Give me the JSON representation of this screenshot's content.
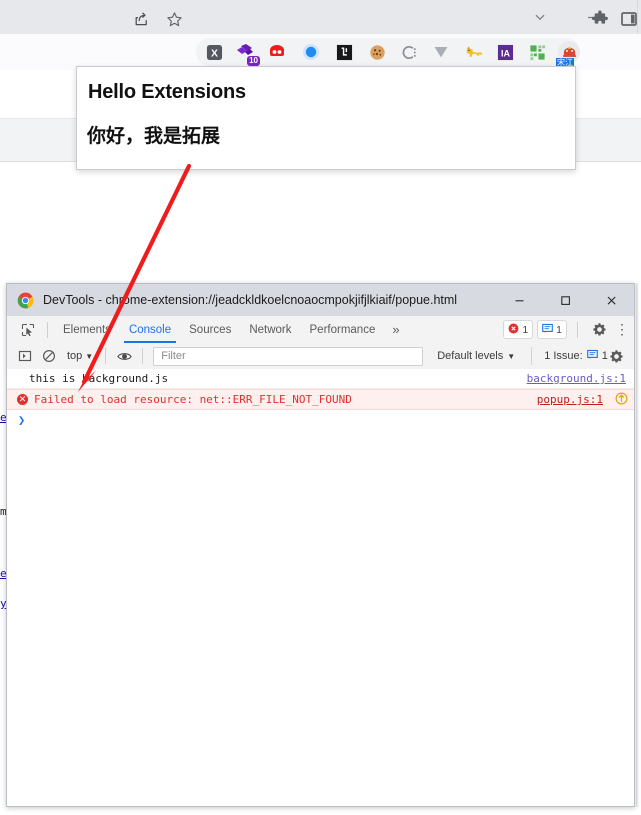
{
  "browser": {
    "titlebar": {
      "chevron_icon": "chevron-down-icon",
      "minimize_icon": "minimize-icon"
    },
    "toolbar": {
      "share_icon": "share-icon",
      "bookmark_star_icon": "star-icon",
      "puzzle_icon": "extensions-puzzle-icon",
      "sidepanel_icon": "side-panel-icon",
      "extensions": [
        {
          "name": "x-extension-icon",
          "glyph": "X",
          "badge": ""
        },
        {
          "name": "purple-diamond-extension-icon",
          "glyph": "",
          "badge": "10"
        },
        {
          "name": "red-mask-extension-icon",
          "glyph": "",
          "badge": ""
        },
        {
          "name": "blue-circle-extension-icon",
          "glyph": "",
          "badge": ""
        },
        {
          "name": "black-square-extension-icon",
          "glyph": "L",
          "badge": ""
        },
        {
          "name": "cookie-extension-icon",
          "glyph": "",
          "badge": ""
        },
        {
          "name": "c-dots-extension-icon",
          "glyph": "C",
          "badge": ""
        },
        {
          "name": "v-chevron-extension-icon",
          "glyph": "V",
          "badge": ""
        },
        {
          "name": "yellow-cat-extension-icon",
          "glyph": "",
          "badge": ""
        },
        {
          "name": "ia-extension-icon",
          "glyph": "IA",
          "badge": ""
        },
        {
          "name": "green-squares-extension-icon",
          "glyph": "",
          "badge": ""
        },
        {
          "name": "hello-extension-icon",
          "glyph": "",
          "badge": "宋江"
        }
      ]
    }
  },
  "popup": {
    "title": "Hello Extensions",
    "subtitle": "你好，我是拓展"
  },
  "devtools": {
    "window": {
      "title": "DevTools - chrome-extension://jeadckldkoelcnoaocmpokjifjlkiaif/popue.html",
      "logo_icon": "chrome-logo-icon",
      "minimize_label": "—",
      "maximize_label": "□",
      "close_label": "✕"
    },
    "tabs": [
      {
        "label": "Elements",
        "active": false
      },
      {
        "label": "Console",
        "active": true
      },
      {
        "label": "Sources",
        "active": false
      },
      {
        "label": "Network",
        "active": false
      },
      {
        "label": "Performance",
        "active": false
      }
    ],
    "more_tabs_label": "»",
    "inspect_icon": "inspect-element-icon",
    "device_toolbar_icon": "device-toolbar-icon",
    "error_count": "1",
    "message_count": "1",
    "settings_icon": "gear-icon",
    "kebab_icon": "more-options-icon",
    "console_toolbar": {
      "sidebar_icon": "console-sidebar-icon",
      "clear_icon": "clear-console-icon",
      "context_label": "top",
      "context_caret": "▼",
      "eye_icon": "live-expression-icon",
      "filter_placeholder": "Filter",
      "filter_value": "",
      "levels_label": "Default levels",
      "levels_caret": "▼",
      "issues_label": "1 Issue:",
      "issues_count": "1",
      "issues_icon": "issue-message-icon",
      "settings_icon": "console-settings-gear-icon"
    },
    "console_messages": [
      {
        "type": "log",
        "text": "this is background.js",
        "source": "background.js:1",
        "has_error_icon": false,
        "has_issue_icon": false
      },
      {
        "type": "error",
        "text": "Failed to load resource: net::ERR_FILE_NOT_FOUND",
        "source": "popup.js:1",
        "has_error_icon": true,
        "has_issue_icon": true,
        "error_icon": "error-circle-icon",
        "issue_icon": "issue-warning-icon"
      }
    ],
    "prompt_symbol": "❯"
  },
  "annotation": {
    "arrow_color": "#ee1c1c",
    "arrow_name": "red-annotation-arrow"
  },
  "bleed_text": {
    "line1": "e",
    "line2": "m",
    "line3": "e",
    "line4": "y"
  },
  "colors": {
    "accent_blue": "#1a73e8",
    "error_red": "#e03030",
    "chrome_gray": "#e7e8ec",
    "devtools_title_gray": "#d7dae0"
  }
}
